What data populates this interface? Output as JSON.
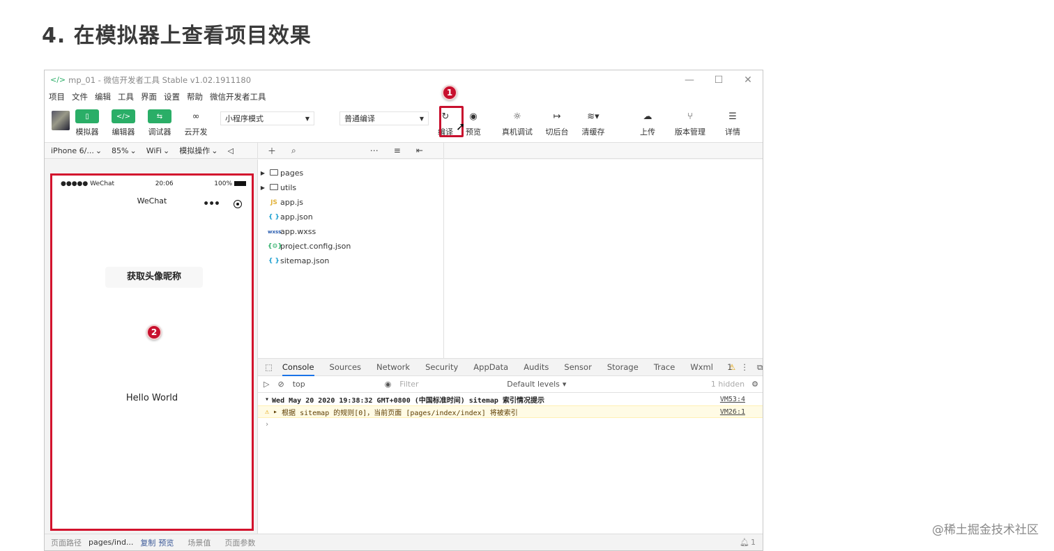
{
  "slide": {
    "title": "4. 在模拟器上查看项目效果",
    "watermark": "@稀土掘金技术社区"
  },
  "window": {
    "title": "mp_01 - 微信开发者工具 Stable v1.02.1911180",
    "controls": [
      "—",
      "☐",
      "✕"
    ]
  },
  "menu": [
    "项目",
    "文件",
    "编辑",
    "工具",
    "界面",
    "设置",
    "帮助",
    "微信开发者工具"
  ],
  "toolbar": {
    "simulator": "模拟器",
    "editor": "编辑器",
    "debugger": "调试器",
    "cloud": "云开发",
    "mode_select": "小程序模式",
    "compile_select": "普通编译",
    "compile": "编译",
    "preview": "预览",
    "real_debug": "真机调试",
    "background": "切后台",
    "clear_cache": "清缓存",
    "upload": "上传",
    "version": "版本管理",
    "details": "详情"
  },
  "annotations": {
    "one": "1",
    "two": "2"
  },
  "subbar": {
    "device": "iPhone 6/...",
    "zoom": "85%",
    "network": "WiFi",
    "sim_ops": "模拟操作"
  },
  "phone": {
    "carrier": "●●●●● WeChat",
    "time": "20:06",
    "battery": "100%",
    "nav_title": "WeChat",
    "button": "获取头像昵称",
    "hello": "Hello World"
  },
  "files": [
    {
      "name": "pages",
      "type": "folder"
    },
    {
      "name": "utils",
      "type": "folder"
    },
    {
      "name": "app.js",
      "type": "js"
    },
    {
      "name": "app.json",
      "type": "json"
    },
    {
      "name": "app.wxss",
      "type": "wxss"
    },
    {
      "name": "project.config.json",
      "type": "config"
    },
    {
      "name": "sitemap.json",
      "type": "json"
    }
  ],
  "devtools": {
    "tabs": [
      "Console",
      "Sources",
      "Network",
      "Security",
      "AppData",
      "Audits",
      "Sensor",
      "Storage",
      "Trace",
      "Wxml"
    ],
    "warn_count": "1",
    "context": "top",
    "filter_placeholder": "Filter",
    "levels": "Default levels",
    "hidden": "1 hidden",
    "log1": "Wed May 20 2020 19:38:32 GMT+0800 (中国标准时间) sitemap 索引情况提示",
    "log1_src": "VM53:4",
    "log2": "根据 sitemap 的规则[0]，当前页面 [pages/index/index] 将被索引",
    "log2_src": "VM26:1"
  },
  "statusbar": {
    "path_label": "页面路径",
    "path": "pages/ind...",
    "copy": "复制",
    "preview": "预览",
    "scene": "场景值",
    "params": "页面参数",
    "notifications": "1"
  },
  "colors": {
    "accent": "#2aae67",
    "highlight": "#c8102e"
  }
}
